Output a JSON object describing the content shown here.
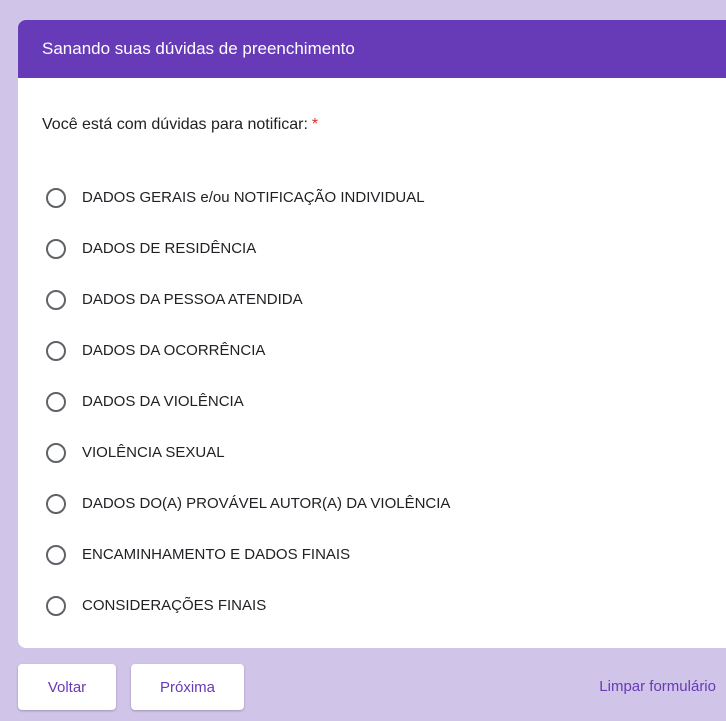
{
  "section": {
    "title": "Sanando suas dúvidas de preenchimento"
  },
  "question": {
    "title": "Você está com dúvidas para notificar:",
    "required_mark": "*",
    "options": [
      {
        "label": "DADOS GERAIS e/ou NOTIFICAÇÃO INDIVIDUAL",
        "selected": false
      },
      {
        "label": "DADOS DE RESIDÊNCIA",
        "selected": false
      },
      {
        "label": "DADOS DA PESSOA ATENDIDA",
        "selected": false
      },
      {
        "label": "DADOS DA OCORRÊNCIA",
        "selected": false
      },
      {
        "label": "DADOS DA VIOLÊNCIA",
        "selected": false
      },
      {
        "label": "VIOLÊNCIA SEXUAL",
        "selected": false
      },
      {
        "label": "DADOS DO(A) PROVÁVEL AUTOR(A) DA VIOLÊNCIA",
        "selected": false
      },
      {
        "label": "ENCAMINHAMENTO E DADOS FINAIS",
        "selected": false
      },
      {
        "label": "CONSIDERAÇÕES FINAIS",
        "selected": false
      }
    ]
  },
  "navigation": {
    "back_label": "Voltar",
    "next_label": "Próxima",
    "clear_label": "Limpar formulário"
  },
  "colors": {
    "accent": "#673ab7",
    "background": "#d1c4e9",
    "required": "#d93025"
  }
}
